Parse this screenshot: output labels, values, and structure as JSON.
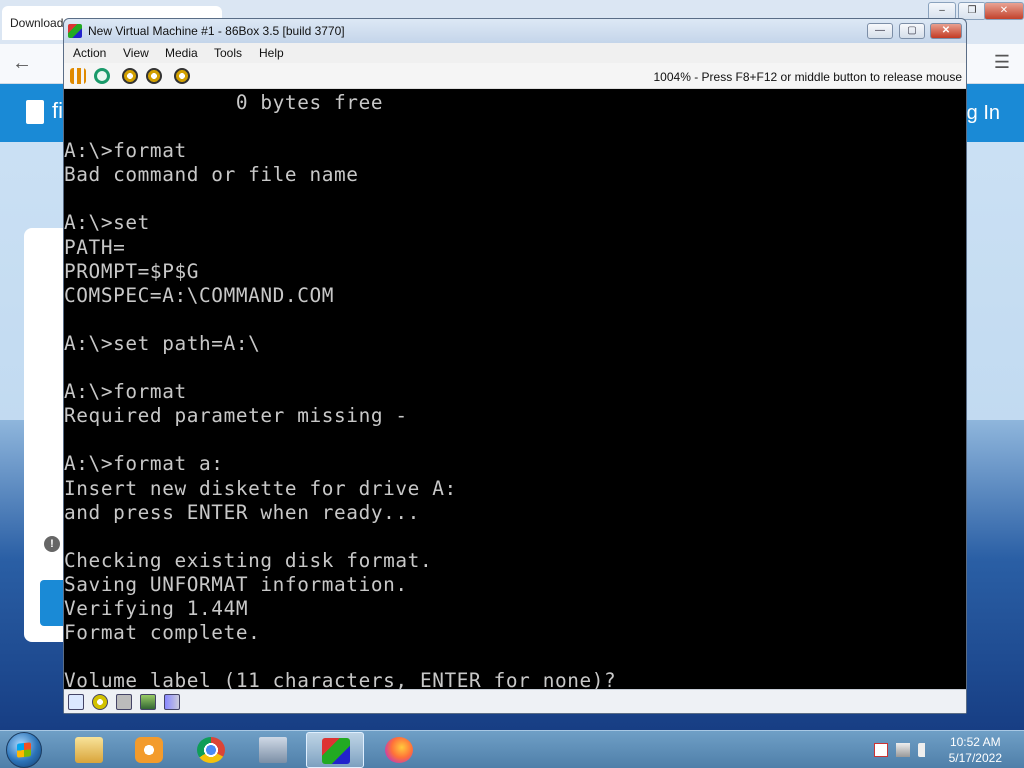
{
  "browser": {
    "tab_title": "Download",
    "window_controls": [
      "–",
      "❐",
      "✕"
    ],
    "back_label": "←",
    "menu_label": "☰",
    "banner_left": "fi",
    "banner_right": "g In",
    "info_label": "!"
  },
  "vm": {
    "title": "New Virtual Machine #1 - 86Box 3.5 [build 3770]",
    "controls": {
      "minimize": "—",
      "maximize": "▢",
      "close": "✕"
    },
    "menu": [
      "Action",
      "View",
      "Media",
      "Tools",
      "Help"
    ],
    "status_text": "1004% - Press F8+F12 or middle button to release mouse",
    "toolbar_icons": [
      "pause-icon",
      "reset-icon",
      "ctrl-alt-del-icon",
      "ctrl-alt-esc-icon",
      "settings-icon"
    ],
    "statusbar_icons": [
      "floppy-icon",
      "cdrom-icon",
      "hdd-icon",
      "network-icon",
      "sound-icon"
    ],
    "console": "              0 bytes free\n\nA:\\>format\nBad command or file name\n\nA:\\>set\nPATH=\nPROMPT=$P$G\nCOMSPEC=A:\\COMMAND.COM\n\nA:\\>set path=A:\\\n\nA:\\>format\nRequired parameter missing -\n\nA:\\>format a:\nInsert new diskette for drive A:\nand press ENTER when ready...\n\nChecking existing disk format.\nSaving UNFORMAT information.\nVerifying 1.44M\nFormat complete.\n\nVolume label (11 characters, ENTER for none)?"
  },
  "taskbar": {
    "items": [
      "windows-explorer-icon",
      "media-player-icon",
      "chrome-icon",
      "computer-icon",
      "86box-icon",
      "firefox-icon"
    ],
    "active_item": "86box-icon",
    "tray_icons": [
      "action-center-icon",
      "network-icon",
      "volume-icon"
    ],
    "clock_time": "10:52 AM",
    "clock_date": "5/17/2022"
  }
}
